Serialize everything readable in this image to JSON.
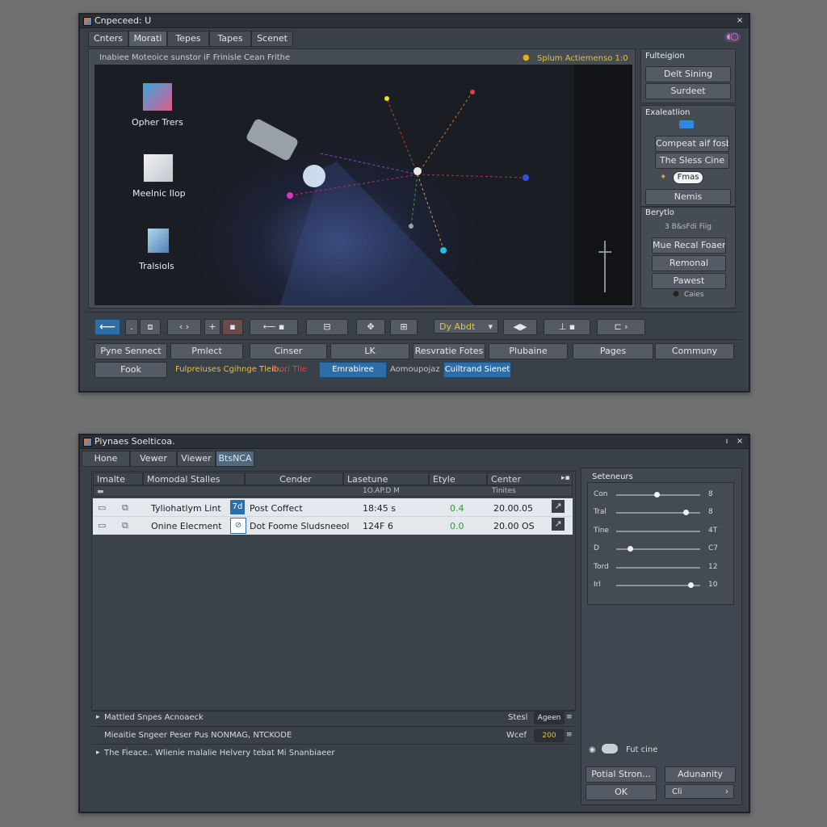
{
  "win1": {
    "title": "Cnpeceed: U",
    "tabs": [
      "Cnters",
      "Morati",
      "Tepes",
      "Tapes",
      "Scenet"
    ],
    "viewport": {
      "caption": "Inabiee Moteoice sunstor iF Frinisle Cean Frithe",
      "status": "Splum Actiemenso 1:0",
      "desktop_icons": [
        "Opher Trers",
        "Meelnic Ilop",
        "Tralsiols"
      ]
    },
    "right": {
      "sec1_title": "Fulteigion",
      "sec1_btns": [
        "Delt Sining",
        "Surdeet"
      ],
      "sec2_title": "Exaleatlion",
      "sec2_btns": [
        "Compeat aif fosb",
        "The Sless Cine",
        "Fmas",
        "Nemis"
      ],
      "sec3_title": "Berytlo",
      "sec3_header": "3 B&sFdi Fiig",
      "sec3_btns": [
        "Mue Recal Foaer",
        "Remonal",
        "Pawest"
      ],
      "sec3_radio": "Caies"
    },
    "toolbar_dropdown": "Dy Abdt",
    "bottom_row1": [
      "Pyne Sennect",
      "Pmlect",
      "Cinser",
      "LK",
      "Resvratie Fotes",
      "Plubaine",
      "Pages",
      "Communy"
    ],
    "bottom_row2": {
      "fook": "Fook",
      "yellow": "Fulpreiuses Cgihnge Tleib...",
      "red": "Frori Tlie",
      "blue1": "Emrabiree",
      "grey": "Aomoupojaz",
      "blue2": "Cuiltrand Sienet"
    }
  },
  "win2": {
    "title": "Piynaes Soelticoa.",
    "tabs": [
      "Hone",
      "Vewer",
      "Viewer",
      "BtsNCA"
    ],
    "columns": [
      "Imalte",
      "Momodal Stalles",
      "Cender",
      "Lasetune",
      "Etyle",
      "Center"
    ],
    "subheader": [
      "1O.AP.D M",
      "Tinites"
    ],
    "rows": [
      {
        "name": "Tyliohatlym Lint",
        "effect": "Post Coffect",
        "time": "18:45 s",
        "val": "0.4",
        "center": "20.00.05"
      },
      {
        "name": "Onine Elecment",
        "effect": "Dot Foome Sludsneeol",
        "time": "124F 6",
        "val": "0.0",
        "center": "20.00 OS"
      }
    ],
    "footer": [
      {
        "text": "Mattled Snpes Acnoaeck",
        "right_label": "Stesl",
        "right_value": "Ageen"
      },
      {
        "text": "Mieaitie Sngeer Peser Pus NONMAG, NTCKODE",
        "right_label": "Wcef",
        "right_value": "200"
      },
      {
        "text": "The Fieace.. Wlienie malalie Helvery tebat Mi Snanbiaeer",
        "right_label": "",
        "right_value": ""
      }
    ],
    "side": {
      "title": "Seteneurs",
      "sliders": [
        {
          "label": "Con",
          "value": "8",
          "level": 0.48
        },
        {
          "label": "Tral",
          "value": "8",
          "level": 0.83
        },
        {
          "label": "Tine",
          "value": "4T",
          "level": 0
        },
        {
          "label": "D",
          "value": "C7",
          "level": 0.16
        },
        {
          "label": "Tord",
          "value": "12",
          "level": 0
        },
        {
          "label": "Irl",
          "value": "10",
          "level": 0.88
        }
      ],
      "toggle_label": "Fut cine",
      "btn1": "Potial Stron...",
      "btn2": "Adunanity",
      "btn3": "OK",
      "btn4": "Cli"
    }
  }
}
